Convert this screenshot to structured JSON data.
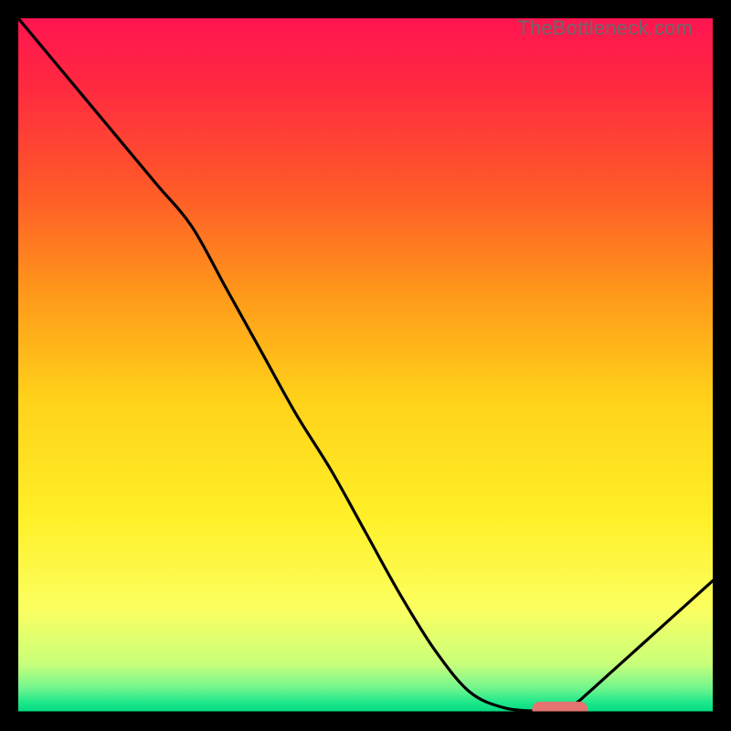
{
  "watermark": "TheBottleneck.com",
  "chart_data": {
    "type": "line",
    "title": "",
    "xlabel": "",
    "ylabel": "",
    "xlim": [
      0,
      100
    ],
    "ylim": [
      0,
      100
    ],
    "grid": false,
    "legend": false,
    "series": [
      {
        "name": "bottleneck-curve",
        "x": [
          0,
          5,
          10,
          15,
          20,
          25,
          30,
          35,
          40,
          45,
          50,
          55,
          60,
          65,
          70,
          75,
          77,
          80,
          82,
          85,
          90,
          95,
          100
        ],
        "y": [
          100,
          94,
          88,
          82,
          76,
          70,
          61,
          52,
          43,
          35,
          26,
          17,
          9,
          3,
          0.7,
          0.2,
          0.2,
          1.2,
          2.8,
          5.5,
          10,
          14.5,
          19
        ]
      }
    ],
    "gradient_stops": [
      {
        "offset": 0.0,
        "color": "#ff1450"
      },
      {
        "offset": 0.1,
        "color": "#ff2a40"
      },
      {
        "offset": 0.25,
        "color": "#ff5a28"
      },
      {
        "offset": 0.4,
        "color": "#ff9a1a"
      },
      {
        "offset": 0.55,
        "color": "#ffd21a"
      },
      {
        "offset": 0.72,
        "color": "#fff028"
      },
      {
        "offset": 0.85,
        "color": "#fcff60"
      },
      {
        "offset": 0.93,
        "color": "#c8ff7a"
      },
      {
        "offset": 0.965,
        "color": "#70f58e"
      },
      {
        "offset": 0.985,
        "color": "#1ee88a"
      },
      {
        "offset": 1.0,
        "color": "#00d980"
      }
    ],
    "marker": {
      "x_center": 78,
      "y_center": 0.5,
      "width": 8,
      "height": 2.2,
      "color": "#e3746f"
    },
    "axis_color": "#000000",
    "curve_color": "#000000"
  }
}
